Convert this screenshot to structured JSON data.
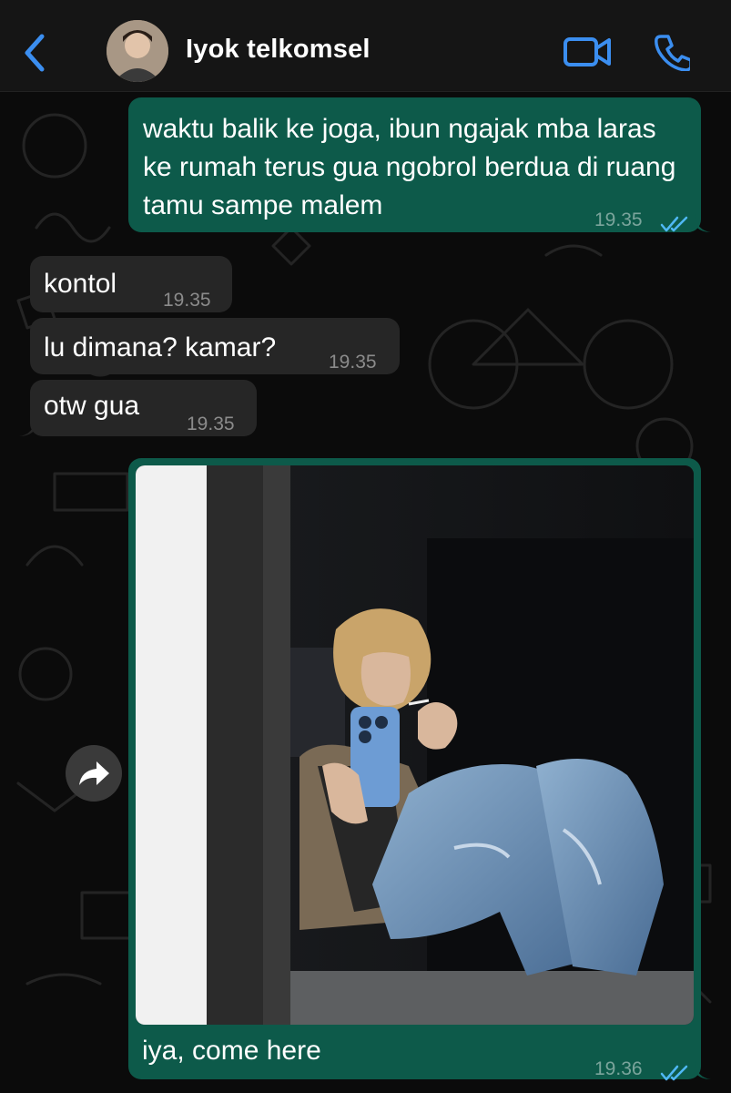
{
  "header": {
    "back_icon": "chevron-left-icon",
    "contact_name": "Iyok telkomsel",
    "video_icon": "video-camera-icon",
    "phone_icon": "phone-icon",
    "accent_color": "#3b8ef0"
  },
  "messages": [
    {
      "direction": "outgoing",
      "text": "waktu balik ke joga, ibun ngajak mba laras ke rumah terus gua ngobrol berdua di ruang tamu sampe malem",
      "time": "19.35",
      "status": "read"
    },
    {
      "direction": "incoming",
      "text": "kontol",
      "time": "19.35"
    },
    {
      "direction": "incoming",
      "text": "lu dimana? kamar?",
      "time": "19.35"
    },
    {
      "direction": "incoming",
      "text": "otw gua",
      "time": "19.35"
    },
    {
      "direction": "outgoing",
      "type": "image",
      "caption": "iya, come here",
      "time": "19.36",
      "status": "read"
    }
  ],
  "forward_icon": "forward-arrow-icon",
  "colors": {
    "outgoing_bubble": "#0d5a4a",
    "incoming_bubble": "#262626",
    "read_ticks": "#4fb8f5",
    "background": "#0b0b0b"
  }
}
